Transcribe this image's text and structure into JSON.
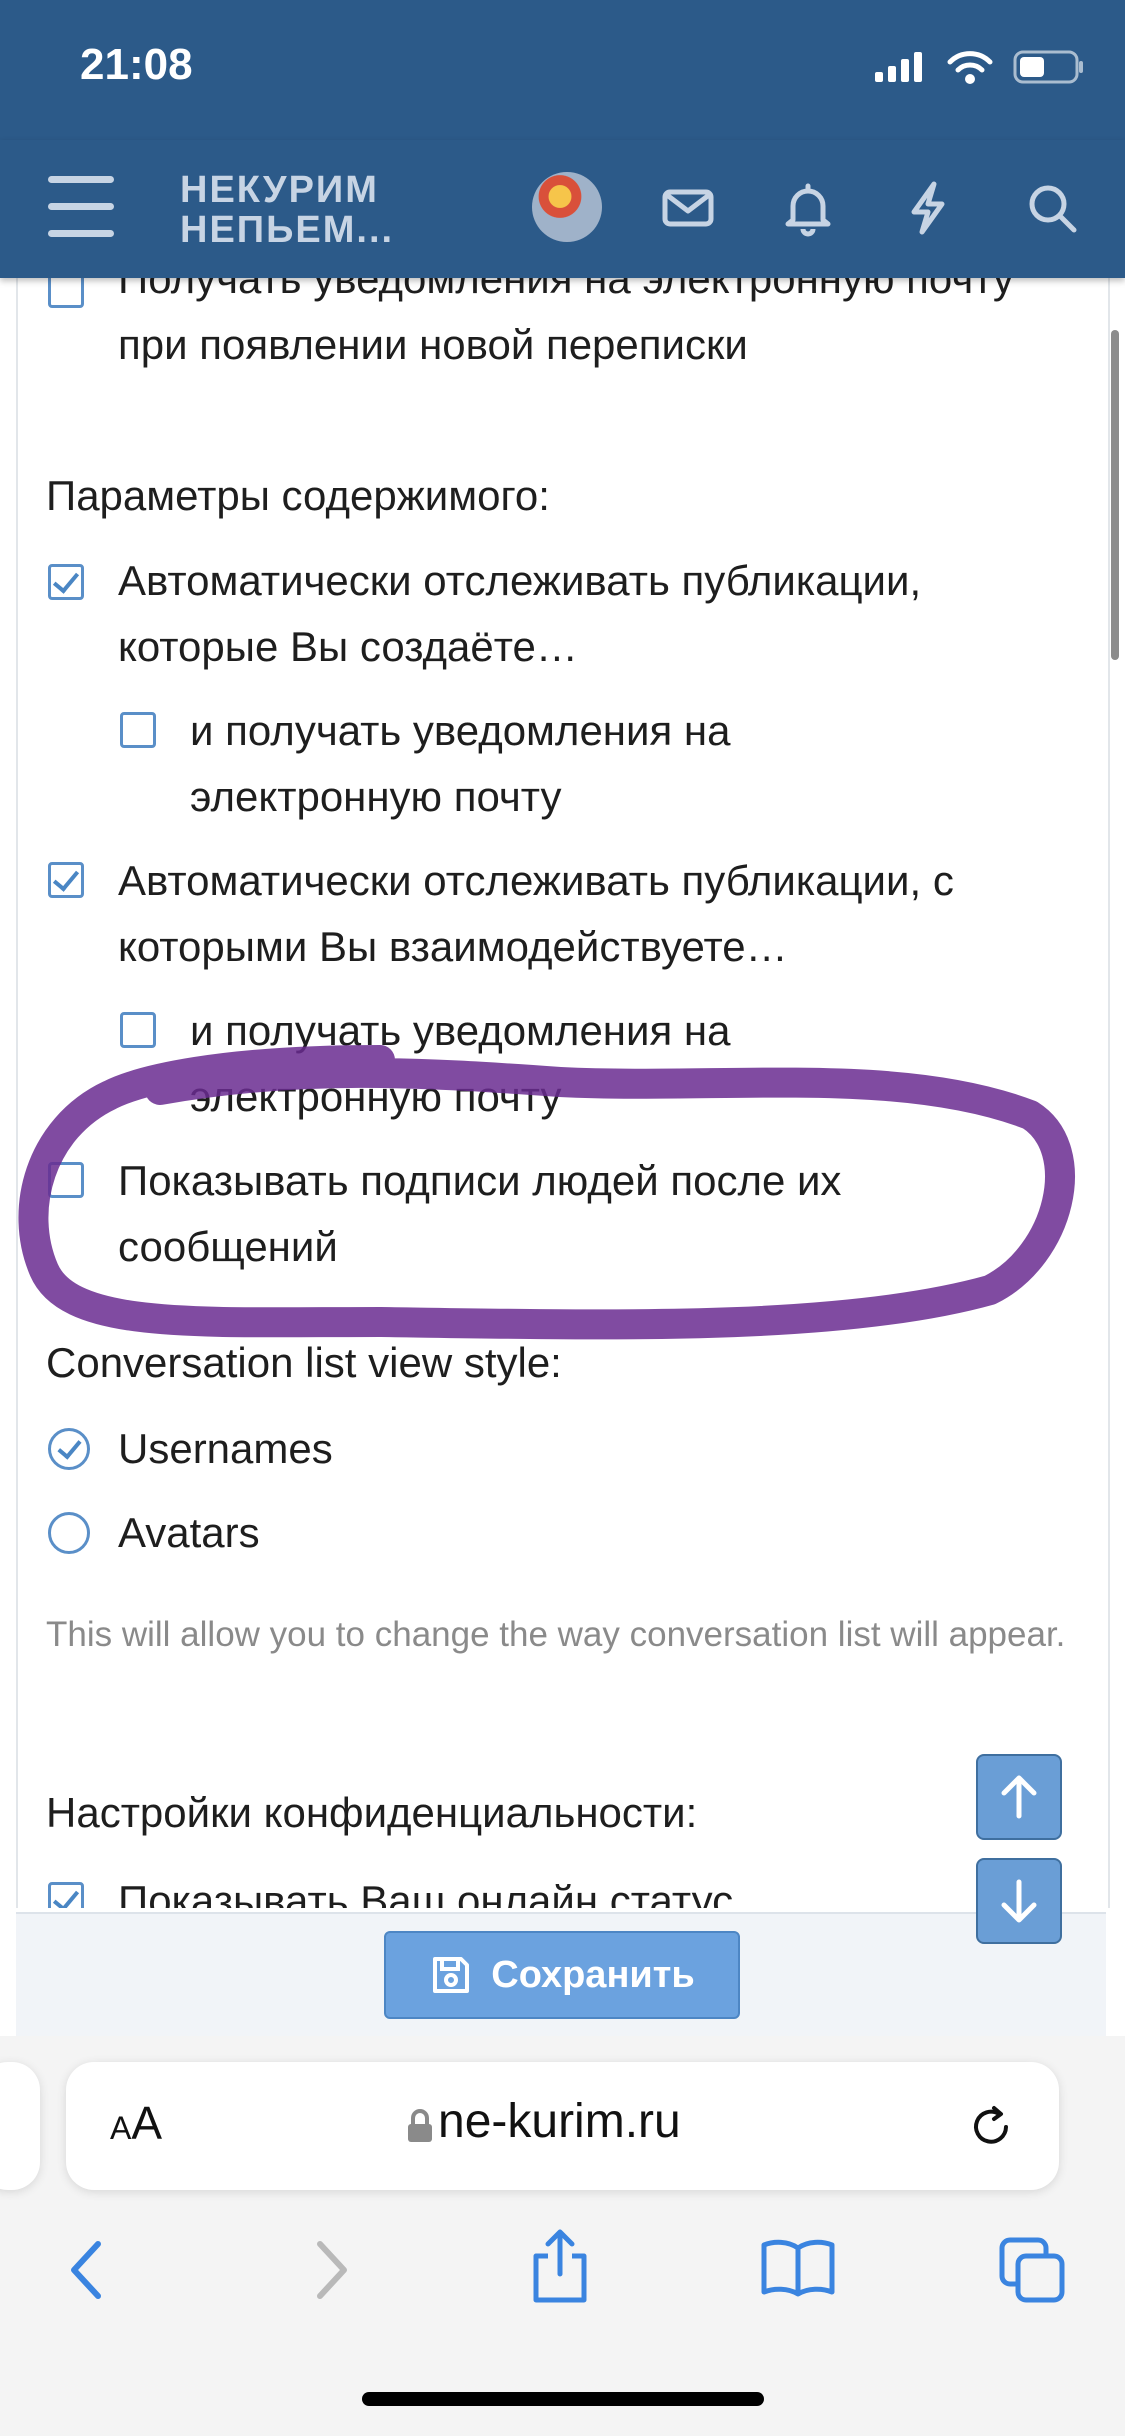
{
  "status": {
    "time": "21:08"
  },
  "header": {
    "logo_line1": "НЕКУРИМ",
    "logo_line2": "НЕПЬЕМ..."
  },
  "settings": {
    "email_conversation": "Получать уведомления на электронную почту при появлении новой переписки",
    "content_heading": "Параметры содержимого:",
    "watch_created": {
      "label": "Автоматически отслеживать публикации, которые Вы создаёте…",
      "checked": true
    },
    "watch_created_email": {
      "label": "и получать уведомления на электронную почту",
      "checked": false
    },
    "watch_interacted": {
      "label": "Автоматически отслеживать публикации, с которыми Вы взаимодействуете…",
      "checked": true
    },
    "watch_interacted_email": {
      "label": "и получать уведомления на электронную почту",
      "checked": false
    },
    "show_signatures": {
      "label": "Показывать подписи людей после их сообщений",
      "checked": false
    },
    "list_style_heading": "Conversation list view style:",
    "list_style_options": [
      {
        "label": "Usernames",
        "checked": true
      },
      {
        "label": "Avatars",
        "checked": false
      }
    ],
    "list_style_hint": "This will allow you to change the way conversation list will appear.",
    "privacy_heading": "Настройки конфиденциальности:",
    "online_status": "Показывать Ваш онлайн статус"
  },
  "footer": {
    "save_label": "Сохранить"
  },
  "browser": {
    "text_size": "AA",
    "url": "ne-kurim.ru"
  },
  "colors": {
    "header": "#2c5a89",
    "accent": "#4a86c4",
    "save": "#6ba2df",
    "highlight": "#6a2c91"
  }
}
